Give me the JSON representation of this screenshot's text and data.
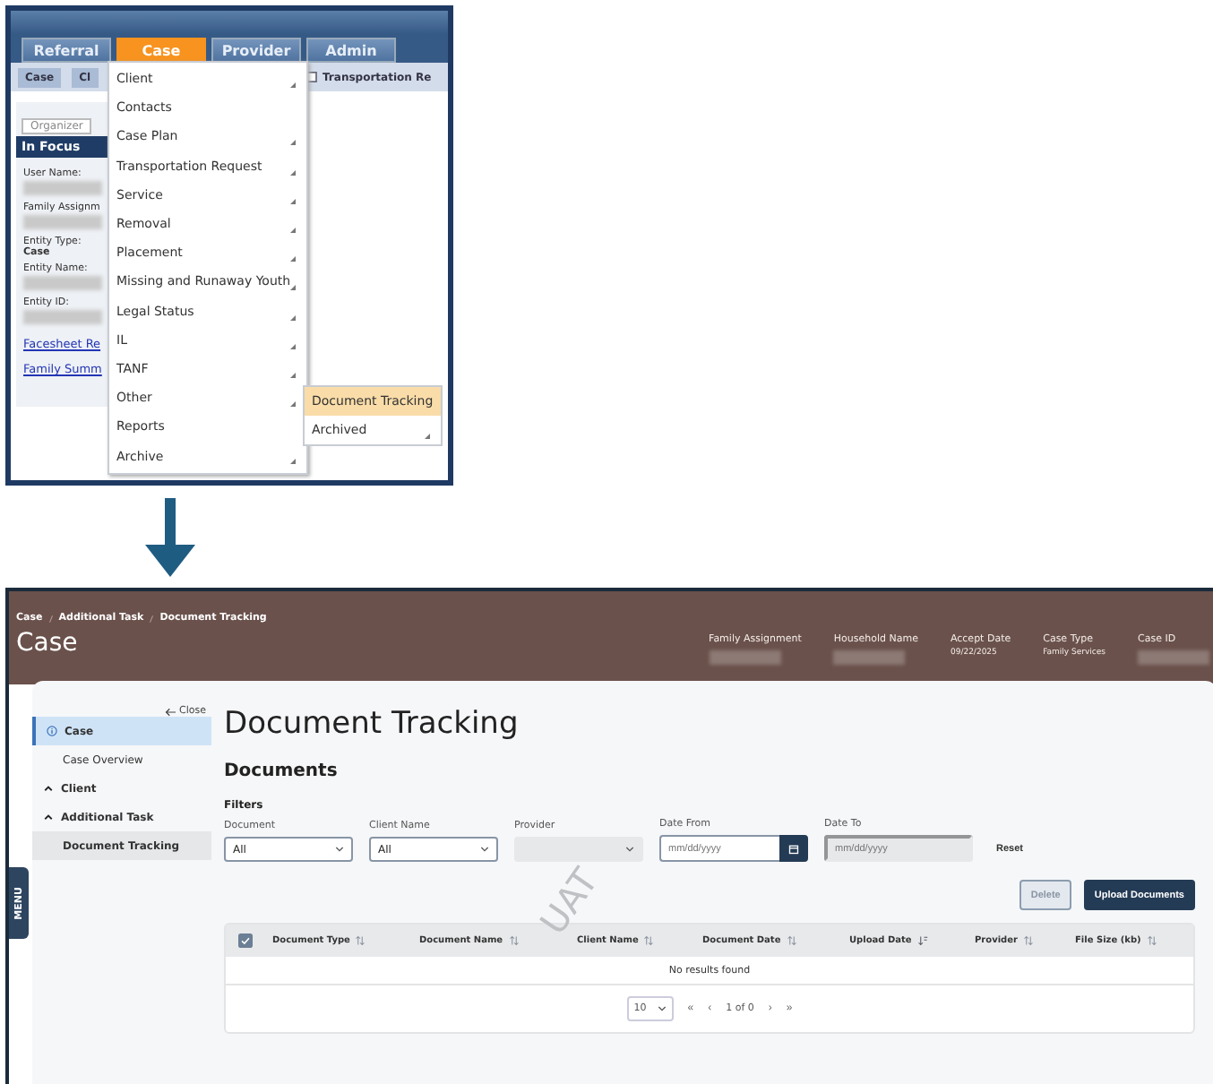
{
  "top_screen": {
    "tabs": [
      {
        "label": "Referral",
        "selected": false
      },
      {
        "label": "Case",
        "selected": true
      },
      {
        "label": "Provider",
        "selected": false
      },
      {
        "label": "Admin",
        "selected": false
      }
    ],
    "breadcrumbs": [
      "Case",
      "Cl"
    ],
    "open_tab": "Transportation Re",
    "organizer_tab": "Organizer",
    "panel_title": "In Focus",
    "fields": [
      {
        "label": "User Name:",
        "redacted": true
      },
      {
        "label": "Family Assignm",
        "redacted": true
      },
      {
        "label": "Entity Type:",
        "value": "Case"
      },
      {
        "label": "Entity Name:",
        "redacted": true
      },
      {
        "label": "Entity ID:",
        "redacted": true
      }
    ],
    "links": [
      "Facesheet Re",
      "Family Summ"
    ],
    "menu": [
      {
        "label": "Client",
        "has_submenu": true
      },
      {
        "label": "Contacts",
        "has_submenu": false
      },
      {
        "label": "Case Plan",
        "has_submenu": true
      },
      {
        "label": "Transportation Request",
        "has_submenu": true
      },
      {
        "label": "Service",
        "has_submenu": true
      },
      {
        "label": "Removal",
        "has_submenu": true
      },
      {
        "label": "Placement",
        "has_submenu": true
      },
      {
        "label": "Missing and Runaway Youth",
        "has_submenu": true
      },
      {
        "label": "Legal Status",
        "has_submenu": true
      },
      {
        "label": "IL",
        "has_submenu": true
      },
      {
        "label": "TANF",
        "has_submenu": true
      },
      {
        "label": "Other",
        "has_submenu": true
      },
      {
        "label": "Reports",
        "has_submenu": false
      },
      {
        "label": "Archive",
        "has_submenu": true
      }
    ],
    "submenu": [
      {
        "label": "Document Tracking",
        "has_submenu": false,
        "selected": true
      },
      {
        "label": "Archived",
        "has_submenu": true,
        "selected": false
      }
    ]
  },
  "bottom_screen": {
    "breadcrumbs": [
      "Case",
      "Additional Task",
      "Document Tracking"
    ],
    "title": "Case",
    "header_fields": [
      {
        "label": "Family Assignment",
        "redacted": true
      },
      {
        "label": "Household Name",
        "redacted": true
      },
      {
        "label": "Accept Date",
        "value": "09/22/2025"
      },
      {
        "label": "Case Type",
        "value": "Family Services"
      },
      {
        "label": "Case ID",
        "redacted": true
      }
    ],
    "close_label": "Close",
    "menu_tab": "MENU",
    "nav": [
      {
        "label": "Case",
        "kind": "info",
        "selected": true,
        "children": [
          {
            "label": "Case Overview",
            "selected": false
          }
        ]
      },
      {
        "label": "Client",
        "kind": "chevron",
        "selected": false
      },
      {
        "label": "Additional Task",
        "kind": "chevron",
        "selected": false,
        "children": [
          {
            "label": "Document Tracking",
            "selected": true
          }
        ]
      }
    ],
    "page_title": "Document Tracking",
    "section_title": "Documents",
    "filters_title": "Filters",
    "filters": [
      {
        "label": "Document",
        "kind": "select",
        "value": "All",
        "disabled": false
      },
      {
        "label": "Client Name",
        "kind": "select",
        "value": "All",
        "disabled": false
      },
      {
        "label": "Provider",
        "kind": "select",
        "disabled": true
      },
      {
        "label": "Date From",
        "kind": "date",
        "placeholder": "mm/dd/yyyy",
        "disabled": false
      },
      {
        "label": "Date To",
        "kind": "date",
        "placeholder": "mm/dd/yyyy",
        "disabled": true
      }
    ],
    "reset": "Reset",
    "buttons": [
      {
        "label": "Delete",
        "kind": "secondary",
        "disabled": true
      },
      {
        "label": "Upload Documents",
        "kind": "primary",
        "disabled": false
      }
    ],
    "table": {
      "select_all_checked": true,
      "columns": [
        {
          "label": "Document Type",
          "sorted": false
        },
        {
          "label": "Document Name",
          "sorted": false
        },
        {
          "label": "Client Name",
          "sorted": false
        },
        {
          "label": "Document Date",
          "sorted": false
        },
        {
          "label": "Upload Date",
          "sorted": true
        },
        {
          "label": "Provider",
          "sorted": false
        },
        {
          "label": "File Size (kb)",
          "sorted": false
        }
      ],
      "empty_message": "No results found"
    },
    "pagination": {
      "page_size": "10",
      "first": "«",
      "prev": "‹",
      "status": "1 of 0",
      "next": "›",
      "last": "»"
    },
    "watermark": "UAT"
  }
}
